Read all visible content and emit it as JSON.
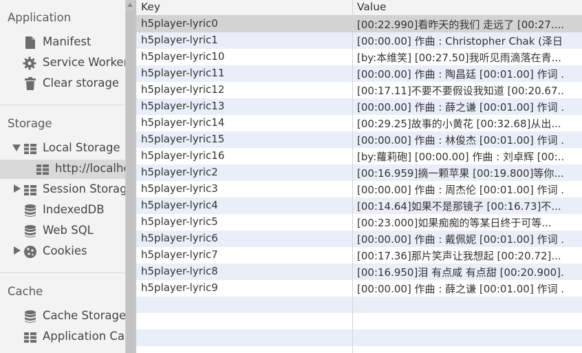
{
  "sidebar": {
    "application": {
      "title": "Application",
      "items": [
        {
          "label": "Manifest"
        },
        {
          "label": "Service Workers"
        },
        {
          "label": "Clear storage"
        }
      ]
    },
    "storage": {
      "title": "Storage",
      "local_storage": {
        "label": "Local Storage",
        "child": "http://localhost"
      },
      "session_storage": {
        "label": "Session Storage"
      },
      "indexeddb": {
        "label": "IndexedDB"
      },
      "websql": {
        "label": "Web SQL"
      },
      "cookies": {
        "label": "Cookies"
      }
    },
    "cache": {
      "title": "Cache",
      "items": [
        {
          "label": "Cache Storage"
        },
        {
          "label": "Application Cache"
        }
      ]
    }
  },
  "table": {
    "columns": {
      "key": "Key",
      "value": "Value"
    },
    "rows": [
      {
        "key": "h5player-lyric0",
        "value": "[00:22.990]看昨天的我们 走远了 [00:27...."
      },
      {
        "key": "h5player-lyric1",
        "value": "[00:00.00] 作曲 : Christopher Chak (泽日..."
      },
      {
        "key": "h5player-lyric10",
        "value": "[by:本维笑] [00:27.50]我听见雨滴落在青..."
      },
      {
        "key": "h5player-lyric11",
        "value": "[00:00.00] 作曲 : 陶昌廷 [00:01.00] 作词 ..."
      },
      {
        "key": "h5player-lyric12",
        "value": "[00:17.11]不要不要假设我知道 [00:20.67..."
      },
      {
        "key": "h5player-lyric13",
        "value": "[00:00.00] 作曲 : 薛之谦 [00:01.00] 作词 ..."
      },
      {
        "key": "h5player-lyric14",
        "value": "[00:29.25]故事的小黄花 [00:32.68]从出..."
      },
      {
        "key": "h5player-lyric15",
        "value": "[00:00.00] 作曲 : 林俊杰 [00:01.00] 作词 ..."
      },
      {
        "key": "h5player-lyric16",
        "value": "[by:蘿莉砲] [00:00.00] 作曲 : 刘卓辉 [00:..."
      },
      {
        "key": "h5player-lyric2",
        "value": "[00:16.959]摘一颗苹果 [00:19.800]等你..."
      },
      {
        "key": "h5player-lyric3",
        "value": "[00:00.00] 作曲 : 周杰伦 [00:01.00] 作词 ..."
      },
      {
        "key": "h5player-lyric4",
        "value": "[00:14.64]如果不是那镜子 [00:16.73]不..."
      },
      {
        "key": "h5player-lyric5",
        "value": "[00:23.000]如果痴痴的等某日终于可等..."
      },
      {
        "key": "h5player-lyric6",
        "value": "[00:00.00] 作曲 : 戴佩妮 [00:01.00] 作词 ..."
      },
      {
        "key": "h5player-lyric7",
        "value": "[00:17.36]那片笑声让我想起 [00:20.72]..."
      },
      {
        "key": "h5player-lyric8",
        "value": "[00:16.950]泪 有点咸 有点甜 [00:20.900]..."
      },
      {
        "key": "h5player-lyric9",
        "value": "[00:00.00] 作曲 : 薛之谦 [00:01.00] 作词 ..."
      },
      {
        "key": "",
        "value": ""
      },
      {
        "key": "",
        "value": ""
      },
      {
        "key": "",
        "value": ""
      },
      {
        "key": "",
        "value": ""
      }
    ],
    "selected_row": 0
  }
}
